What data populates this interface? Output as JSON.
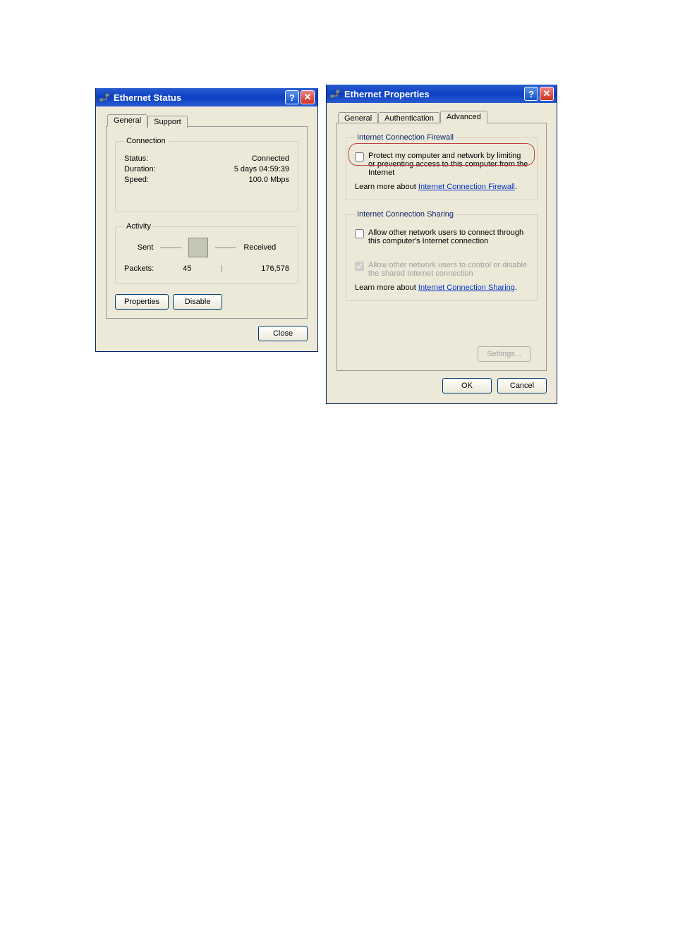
{
  "status_dialog": {
    "title": "Ethernet Status",
    "tabs": {
      "general": "General",
      "support": "Support"
    },
    "connection": {
      "legend": "Connection",
      "status_label": "Status:",
      "status_value": "Connected",
      "duration_label": "Duration:",
      "duration_value": "5 days 04:59:39",
      "speed_label": "Speed:",
      "speed_value": "100.0 Mbps"
    },
    "activity": {
      "legend": "Activity",
      "sent_label": "Sent",
      "received_label": "Received",
      "packets_label": "Packets:",
      "sent_value": "45",
      "received_value": "176,578"
    },
    "buttons": {
      "properties": "Properties",
      "disable": "Disable",
      "close": "Close"
    }
  },
  "props_dialog": {
    "title": "Ethernet Properties",
    "tabs": {
      "general": "General",
      "auth": "Authentication",
      "advanced": "Advanced"
    },
    "icf": {
      "legend": "Internet Connection Firewall",
      "check_label": "Protect my computer and network by limiting or preventing access to this computer from the Internet",
      "learn_prefix": "Learn more about ",
      "learn_link": "Internet Connection Firewall",
      "learn_suffix": "."
    },
    "ics": {
      "legend": "Internet Connection Sharing",
      "allow_connect": "Allow other network users to connect through this computer's Internet connection",
      "allow_control": "Allow other network users to control or disable the shared Internet connection",
      "learn_prefix": "Learn more about ",
      "learn_link": "Internet Connection Sharing",
      "learn_suffix": "."
    },
    "buttons": {
      "settings": "Settings...",
      "ok": "OK",
      "cancel": "Cancel"
    }
  }
}
